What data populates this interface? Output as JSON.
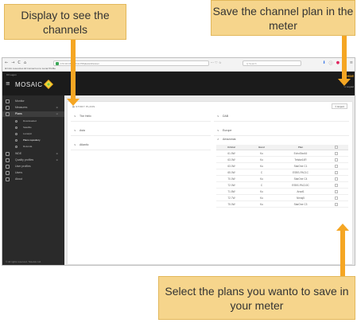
{
  "callouts": {
    "top_left": "Display to see the channels",
    "top_right": "Save the channel plan in the meter",
    "bottom": "Select the plans you wanto to save in your meter"
  },
  "browser": {
    "nav_icons": [
      "←",
      "→",
      "C",
      "⌂"
    ],
    "url": "172.16.16.2/admin/?#/plans/channel",
    "url_icons": "··· ♡ ☆",
    "search_placeholder": "Q Search",
    "bookmarks": "⊕ Intro resources  ⊕ Connect us to Lunar Profile",
    "right_icons": [
      "⬇",
      "ⓘ",
      "●",
      "□",
      "≡"
    ]
  },
  "app": {
    "login": "≡≡ Logon",
    "menu_icon": "≡",
    "logo_text": "MOSAIC",
    "brand": "ROHDE",
    "logout": "↪ Logout"
  },
  "sidebar": {
    "items": [
      {
        "label": "Monitor",
        "chev": ""
      },
      {
        "label": "Measures",
        "chev": "⊕"
      },
      {
        "label": "Plans",
        "chev": "⊖",
        "active": true
      },
      {
        "label": "Downloaded",
        "sub": true
      },
      {
        "label": "Satellite",
        "sub": true
      },
      {
        "label": "Lunarpit",
        "sub": true
      },
      {
        "label": "Plans repository",
        "sub": true,
        "on": true
      },
      {
        "label": "Rotunda",
        "sub": true
      },
      {
        "label": "WDE",
        "chev": "⊕"
      },
      {
        "label": "Quality profiles",
        "chev": "⊕"
      },
      {
        "label": "User profiles",
        "chev": ""
      },
      {
        "label": "Users",
        "chev": ""
      },
      {
        "label": "About",
        "chev": ""
      }
    ],
    "footer": "© All rights reserved, Tekelsis Ltd."
  },
  "main": {
    "title": "▤ STORY PLANS",
    "export": "⇪ Export",
    "sections_left": [
      {
        "label": "The Helix",
        "arrow": "∨"
      },
      {
        "label": "Asia",
        "arrow": "∨"
      },
      {
        "label": "Atlantic",
        "arrow": "∨"
      }
    ],
    "sections_right": [
      {
        "label": "DAB",
        "arrow": "∨"
      },
      {
        "label": "Europe",
        "arrow": "∨"
      },
      {
        "label": "Amazonas",
        "arrow": "∧"
      }
    ],
    "table": {
      "headers": [
        "Orbital",
        "Band",
        "Plan",
        ""
      ],
      "rows": [
        [
          "61.5W",
          "Ku",
          "EchoStar16"
        ],
        [
          "63.0W",
          "Ku",
          "Telstar14R"
        ],
        [
          "63.0W",
          "Ku",
          "StarOne C1"
        ],
        [
          "65.0W",
          "C",
          "ESBS-PAC1C"
        ],
        [
          "70.0W",
          "Ku",
          "StarOne C4"
        ],
        [
          "72.0W",
          "C",
          "ESBS-PAC10C"
        ],
        [
          "71.8W",
          "Ku",
          "Arsat1"
        ],
        [
          "72.7W",
          "Ku",
          "Nimiq5"
        ],
        [
          "75.0W",
          "Ku",
          "StarOne C3"
        ]
      ]
    }
  }
}
